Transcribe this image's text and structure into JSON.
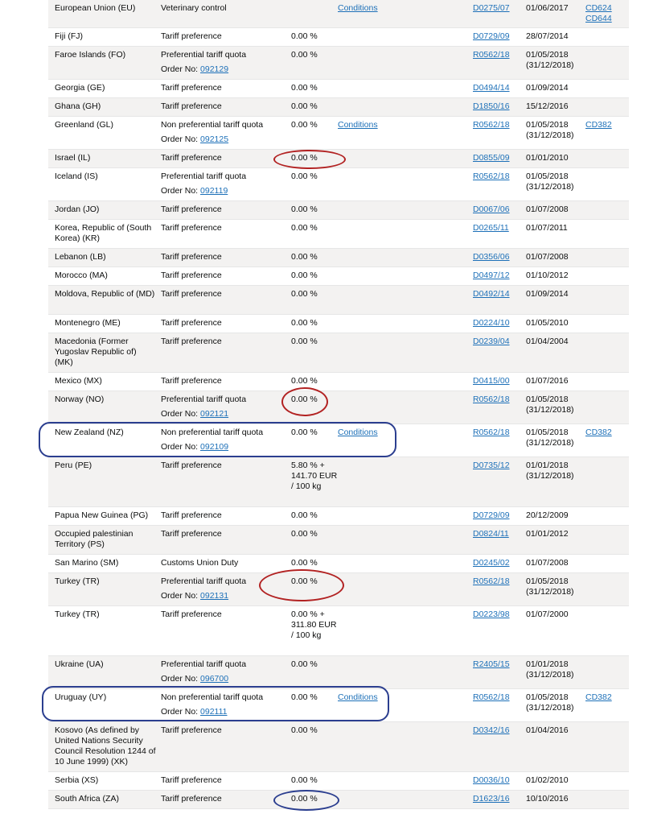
{
  "rows": [
    {
      "country": "European Union (EU)",
      "measure": "Veterinary control",
      "duty": "",
      "conditions": "Conditions",
      "regulation": "D0275/07",
      "date": "01/06/2017",
      "date_end": "",
      "footnotes": [
        "CD624",
        "CD644"
      ],
      "order_label": "",
      "order_no": ""
    },
    {
      "country": "Fiji (FJ)",
      "measure": "Tariff preference",
      "duty": "0.00 %",
      "conditions": "",
      "regulation": "D0729/09",
      "date": "28/07/2014",
      "date_end": "",
      "footnotes": [],
      "order_label": "",
      "order_no": ""
    },
    {
      "country": "Faroe Islands (FO)",
      "measure": "Preferential tariff quota",
      "duty": "0.00 %",
      "conditions": "",
      "regulation": "R0562/18",
      "date": "01/05/2018",
      "date_end": "(31/12/2018)",
      "footnotes": [],
      "order_label": "Order No:",
      "order_no": "092129"
    },
    {
      "country": "Georgia (GE)",
      "measure": "Tariff preference",
      "duty": "0.00 %",
      "conditions": "",
      "regulation": "D0494/14",
      "date": "01/09/2014",
      "date_end": "",
      "footnotes": [],
      "order_label": "",
      "order_no": ""
    },
    {
      "country": "Ghana (GH)",
      "measure": "Tariff preference",
      "duty": "0.00 %",
      "conditions": "",
      "regulation": "D1850/16",
      "date": "15/12/2016",
      "date_end": "",
      "footnotes": [],
      "order_label": "",
      "order_no": ""
    },
    {
      "country": "Greenland (GL)",
      "measure": "Non preferential tariff quota",
      "duty": "0.00 %",
      "conditions": "Conditions",
      "regulation": "R0562/18",
      "date": "01/05/2018",
      "date_end": "(31/12/2018)",
      "footnotes": [
        "CD382"
      ],
      "order_label": "Order No:",
      "order_no": "092125"
    },
    {
      "country": "Israel (IL)",
      "measure": "Tariff preference",
      "duty": "0.00 %",
      "conditions": "",
      "regulation": "D0855/09",
      "date": "01/01/2010",
      "date_end": "",
      "footnotes": [],
      "order_label": "",
      "order_no": ""
    },
    {
      "country": "Iceland (IS)",
      "measure": "Preferential tariff quota",
      "duty": "0.00 %",
      "conditions": "",
      "regulation": "R0562/18",
      "date": "01/05/2018",
      "date_end": "(31/12/2018)",
      "footnotes": [],
      "order_label": "Order No:",
      "order_no": "092119"
    },
    {
      "country": "Jordan (JO)",
      "measure": "Tariff preference",
      "duty": "0.00 %",
      "conditions": "",
      "regulation": "D0067/06",
      "date": "01/07/2008",
      "date_end": "",
      "footnotes": [],
      "order_label": "",
      "order_no": ""
    },
    {
      "country": "Korea, Republic of (South Korea) (KR)",
      "measure": "Tariff preference",
      "duty": "0.00 %",
      "conditions": "",
      "regulation": "D0265/11",
      "date": "01/07/2011",
      "date_end": "",
      "footnotes": [],
      "order_label": "",
      "order_no": ""
    },
    {
      "country": "Lebanon (LB)",
      "measure": "Tariff preference",
      "duty": "0.00 %",
      "conditions": "",
      "regulation": "D0356/06",
      "date": "01/07/2008",
      "date_end": "",
      "footnotes": [],
      "order_label": "",
      "order_no": ""
    },
    {
      "country": "Morocco (MA)",
      "measure": "Tariff preference",
      "duty": "0.00 %",
      "conditions": "",
      "regulation": "D0497/12",
      "date": "01/10/2012",
      "date_end": "",
      "footnotes": [],
      "order_label": "",
      "order_no": ""
    },
    {
      "country": "Moldova, Republic of (MD)",
      "measure": "Tariff preference",
      "duty": "0.00 %",
      "conditions": "",
      "regulation": "D0492/14",
      "date": "01/09/2014",
      "date_end": "",
      "footnotes": [],
      "order_label": "",
      "order_no": ""
    },
    {
      "country": "Montenegro (ME)",
      "measure": "Tariff preference",
      "duty": "0.00 %",
      "conditions": "",
      "regulation": "D0224/10",
      "date": "01/05/2010",
      "date_end": "",
      "footnotes": [],
      "order_label": "",
      "order_no": ""
    },
    {
      "country": "Macedonia (Former Yugoslav Republic of) (MK)",
      "measure": "Tariff preference",
      "duty": "0.00 %",
      "conditions": "",
      "regulation": "D0239/04",
      "date": "01/04/2004",
      "date_end": "",
      "footnotes": [],
      "order_label": "",
      "order_no": ""
    },
    {
      "country": "Mexico (MX)",
      "measure": "Tariff preference",
      "duty": "0.00 %",
      "conditions": "",
      "regulation": "D0415/00",
      "date": "01/07/2016",
      "date_end": "",
      "footnotes": [],
      "order_label": "",
      "order_no": ""
    },
    {
      "country": "Norway (NO)",
      "measure": "Preferential tariff quota",
      "duty": "0.00 %",
      "conditions": "",
      "regulation": "R0562/18",
      "date": "01/05/2018",
      "date_end": "(31/12/2018)",
      "footnotes": [],
      "order_label": "Order No:",
      "order_no": "092121"
    },
    {
      "country": "New Zealand (NZ)",
      "measure": "Non preferential tariff quota",
      "duty": "0.00 %",
      "conditions": "Conditions",
      "regulation": "R0562/18",
      "date": "01/05/2018",
      "date_end": "(31/12/2018)",
      "footnotes": [
        "CD382"
      ],
      "order_label": "Order No:",
      "order_no": "092109"
    },
    {
      "country": "Peru (PE)",
      "measure": "Tariff preference",
      "duty": "5.80 % + 141.70 EUR / 100 kg",
      "conditions": "",
      "regulation": "D0735/12",
      "date": "01/01/2018",
      "date_end": "(31/12/2018)",
      "footnotes": [],
      "order_label": "",
      "order_no": ""
    },
    {
      "country": "Papua New Guinea (PG)",
      "measure": "Tariff preference",
      "duty": "0.00 %",
      "conditions": "",
      "regulation": "D0729/09",
      "date": "20/12/2009",
      "date_end": "",
      "footnotes": [],
      "order_label": "",
      "order_no": ""
    },
    {
      "country": "Occupied palestinian Territory (PS)",
      "measure": "Tariff preference",
      "duty": "0.00 %",
      "conditions": "",
      "regulation": "D0824/11",
      "date": "01/01/2012",
      "date_end": "",
      "footnotes": [],
      "order_label": "",
      "order_no": ""
    },
    {
      "country": "San Marino (SM)",
      "measure": "Customs Union Duty",
      "duty": "0.00 %",
      "conditions": "",
      "regulation": "D0245/02",
      "date": "01/07/2008",
      "date_end": "",
      "footnotes": [],
      "order_label": "",
      "order_no": ""
    },
    {
      "country": "Turkey (TR)",
      "measure": "Preferential tariff quota",
      "duty": "0.00 %",
      "conditions": "",
      "regulation": "R0562/18",
      "date": "01/05/2018",
      "date_end": "(31/12/2018)",
      "footnotes": [],
      "order_label": "Order No:",
      "order_no": "092131"
    },
    {
      "country": "Turkey (TR)",
      "measure": "Tariff preference",
      "duty": "0.00 % + 311.80 EUR / 100 kg",
      "conditions": "",
      "regulation": "D0223/98",
      "date": "01/07/2000",
      "date_end": "",
      "footnotes": [],
      "order_label": "",
      "order_no": ""
    },
    {
      "country": "Ukraine (UA)",
      "measure": "Preferential tariff quota",
      "duty": "0.00 %",
      "conditions": "",
      "regulation": "R2405/15",
      "date": "01/01/2018",
      "date_end": "(31/12/2018)",
      "footnotes": [],
      "order_label": "Order No:",
      "order_no": "096700"
    },
    {
      "country": "Uruguay (UY)",
      "measure": "Non preferential tariff quota",
      "duty": "0.00 %",
      "conditions": "Conditions",
      "regulation": "R0562/18",
      "date": "01/05/2018",
      "date_end": "(31/12/2018)",
      "footnotes": [
        "CD382"
      ],
      "order_label": "Order No:",
      "order_no": "092111"
    },
    {
      "country": "Kosovo (As defined by United Nations Security Council Resolution 1244 of 10 June 1999) (XK)",
      "measure": "Tariff preference",
      "duty": "0.00 %",
      "conditions": "",
      "regulation": "D0342/16",
      "date": "01/04/2016",
      "date_end": "",
      "footnotes": [],
      "order_label": "",
      "order_no": ""
    },
    {
      "country": "Serbia (XS)",
      "measure": "Tariff preference",
      "duty": "0.00 %",
      "conditions": "",
      "regulation": "D0036/10",
      "date": "01/02/2010",
      "date_end": "",
      "footnotes": [],
      "order_label": "",
      "order_no": ""
    },
    {
      "country": "South Africa (ZA)",
      "measure": "Tariff preference",
      "duty": "0.00 %",
      "conditions": "",
      "regulation": "D1623/16",
      "date": "10/10/2016",
      "date_end": "",
      "footnotes": [],
      "order_label": "",
      "order_no": ""
    }
  ],
  "colors": {
    "link": "#1d70b8",
    "text": "#0b0c0c",
    "row_alt_bg": "#f3f2f1",
    "annotation_red": "#b22222",
    "annotation_blue": "#2b3e8f"
  }
}
